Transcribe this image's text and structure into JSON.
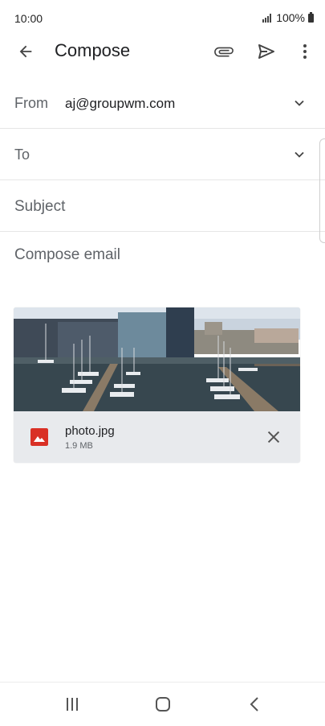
{
  "status": {
    "time": "10:00",
    "battery": "100%"
  },
  "app_bar": {
    "title": "Compose"
  },
  "form": {
    "from_label": "From",
    "from_value": "aj@groupwm.com",
    "to_label": "To",
    "subject_placeholder": "Subject",
    "body_placeholder": "Compose email"
  },
  "attachment": {
    "file_name": "photo.jpg",
    "file_size": "1.9 MB"
  },
  "icons": {
    "back": "arrow-back-icon",
    "attach": "paperclip-icon",
    "send": "send-icon",
    "more": "more-vert-icon",
    "file_type": "image-icon",
    "remove": "close-icon",
    "recents": "recents-icon",
    "home": "home-icon",
    "nav_back": "nav-back-icon"
  },
  "colors": {
    "accent": "#d93025",
    "attachment_bg": "#e8eaed"
  }
}
